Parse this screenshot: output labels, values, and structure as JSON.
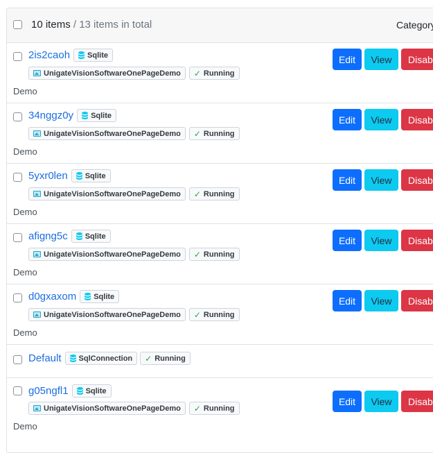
{
  "header": {
    "count_main": "10 items",
    "count_sub": " / 13 items in total",
    "category_label": "Category"
  },
  "actions": {
    "edit": "Edit",
    "view": "View",
    "disable": "Disable"
  },
  "rows": [
    {
      "name": "2is2caoh",
      "db": "Sqlite",
      "project": "UnigateVisionSoftwareOnePageDemo",
      "status": "Running",
      "tag": "Demo"
    },
    {
      "name": "34nggz0y",
      "db": "Sqlite",
      "project": "UnigateVisionSoftwareOnePageDemo",
      "status": "Running",
      "tag": "Demo"
    },
    {
      "name": "5yxr0len",
      "db": "Sqlite",
      "project": "UnigateVisionSoftwareOnePageDemo",
      "status": "Running",
      "tag": "Demo"
    },
    {
      "name": "afigng5c",
      "db": "Sqlite",
      "project": "UnigateVisionSoftwareOnePageDemo",
      "status": "Running",
      "tag": "Demo"
    },
    {
      "name": "d0gxaxom",
      "db": "Sqlite",
      "project": "UnigateVisionSoftwareOnePageDemo",
      "status": "Running",
      "tag": "Demo"
    },
    {
      "name": "Default",
      "db": "SqlConnection",
      "status": "Running"
    },
    {
      "name": "g05ngfl1",
      "db": "Sqlite",
      "project": "UnigateVisionSoftwareOnePageDemo",
      "status": "Running",
      "tag": "Demo"
    }
  ],
  "colors": {
    "primary": "#0d6efd",
    "info": "#0dcaf0",
    "danger": "#dc3545",
    "link": "#1b6ee0",
    "success": "#28a745"
  }
}
